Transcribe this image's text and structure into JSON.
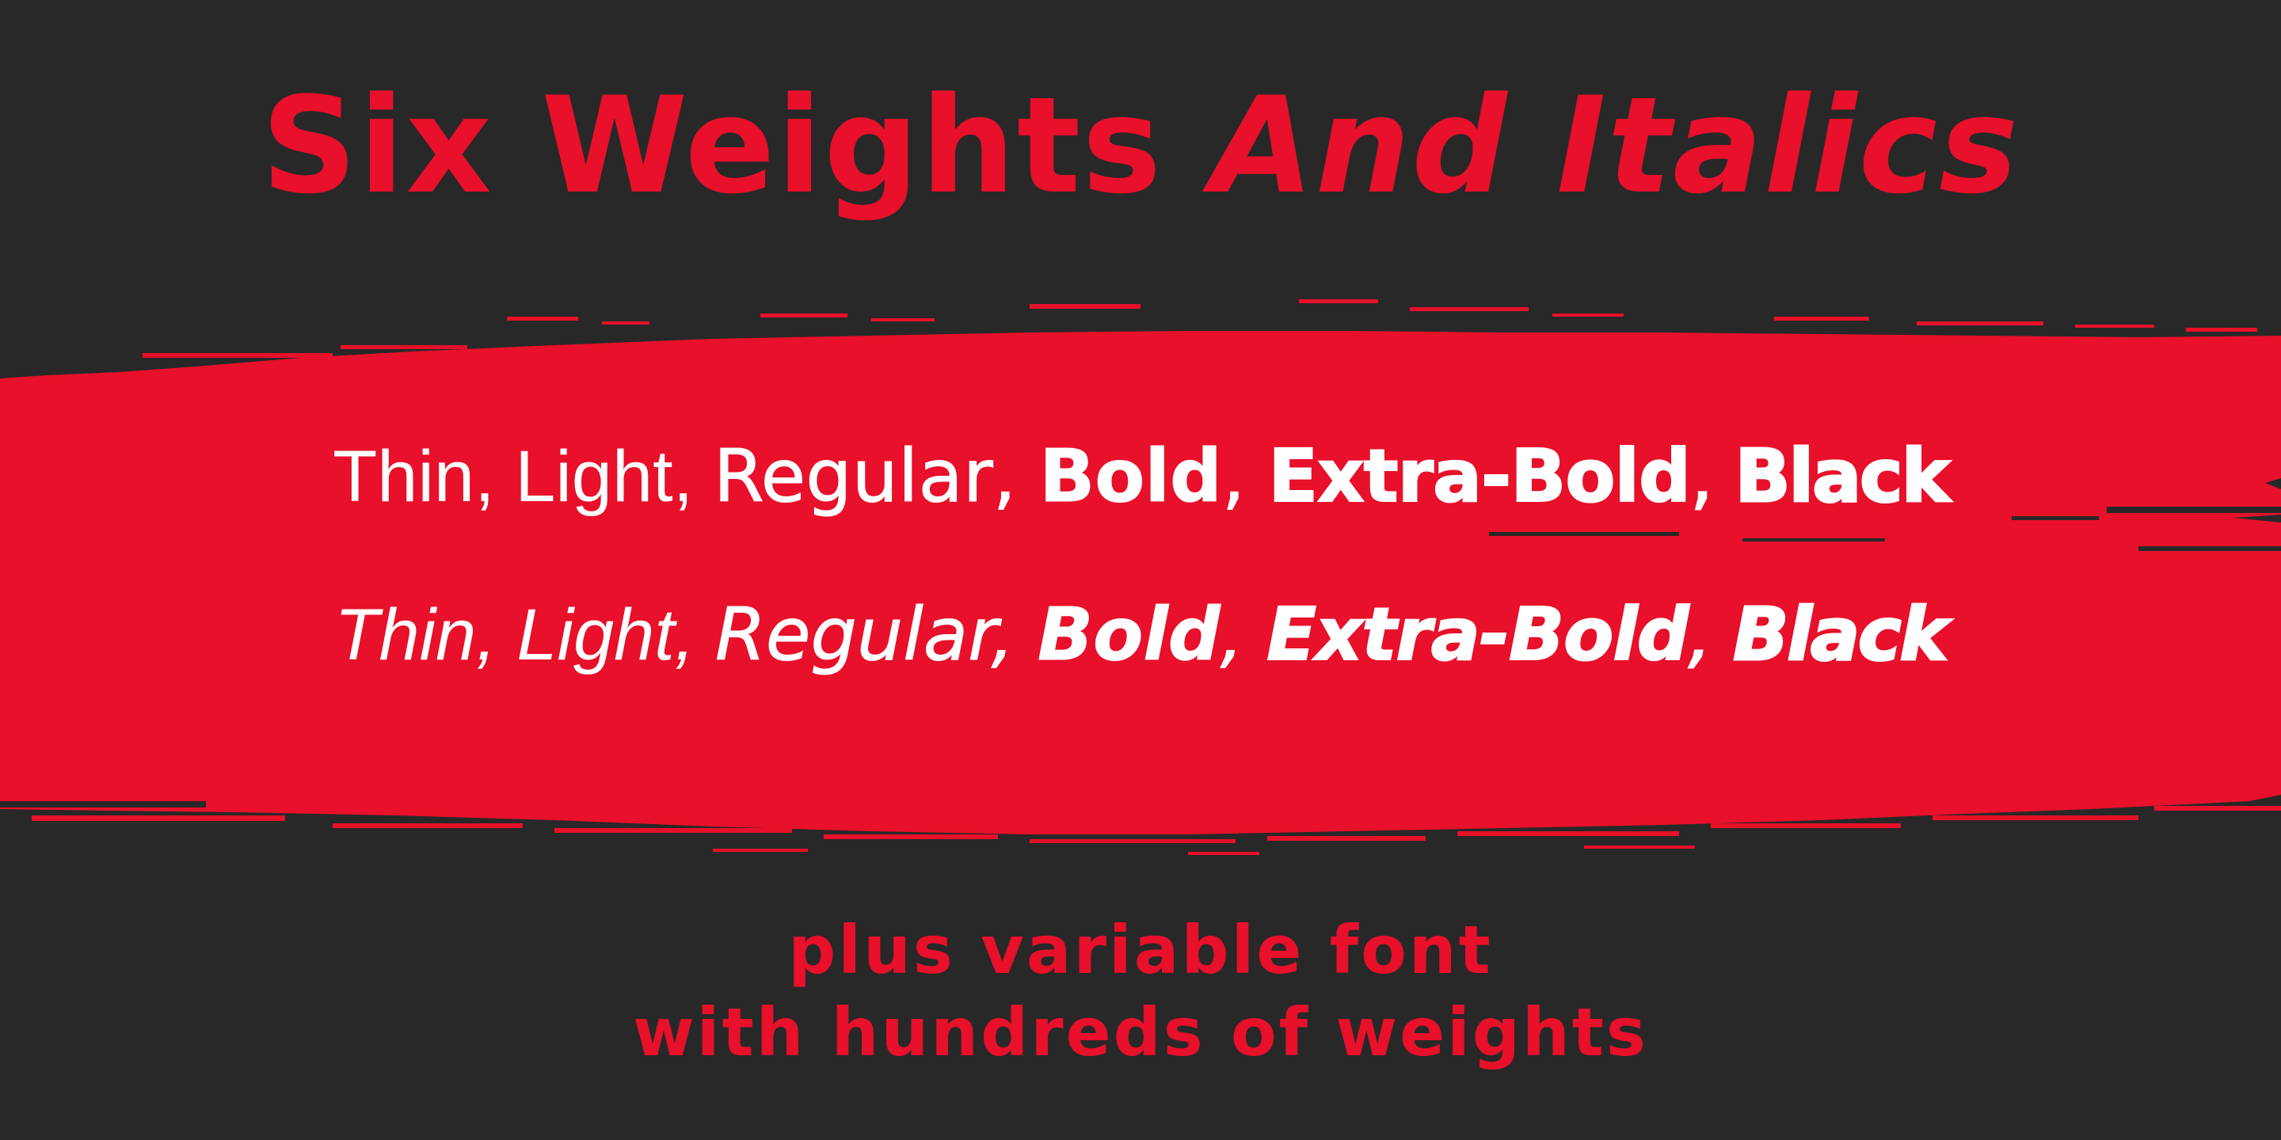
{
  "colors": {
    "background": "#282828",
    "accent": "#E8102A",
    "text_on_accent": "#FFFFFF"
  },
  "title": {
    "upright": "Six Weights",
    "italic": "And Italics"
  },
  "weights": {
    "upright": [
      {
        "label": "Thin",
        "sep": ", "
      },
      {
        "label": "Light",
        "sep": ", "
      },
      {
        "label": "Regular",
        "sep": ", "
      },
      {
        "label": "Bold",
        "sep": ", "
      },
      {
        "label": "Extra-Bold",
        "sep": ", "
      },
      {
        "label": "Black",
        "sep": ""
      }
    ],
    "italic": [
      {
        "label": "Thin",
        "sep": ", "
      },
      {
        "label": "Light",
        "sep": ", "
      },
      {
        "label": "Regular",
        "sep": ", "
      },
      {
        "label": "Bold",
        "sep": ", "
      },
      {
        "label": "Extra-Bold",
        "sep": ", "
      },
      {
        "label": "Black",
        "sep": ""
      }
    ]
  },
  "tagline": {
    "line1": "plus variable font",
    "line2": "with hundreds of weights"
  }
}
